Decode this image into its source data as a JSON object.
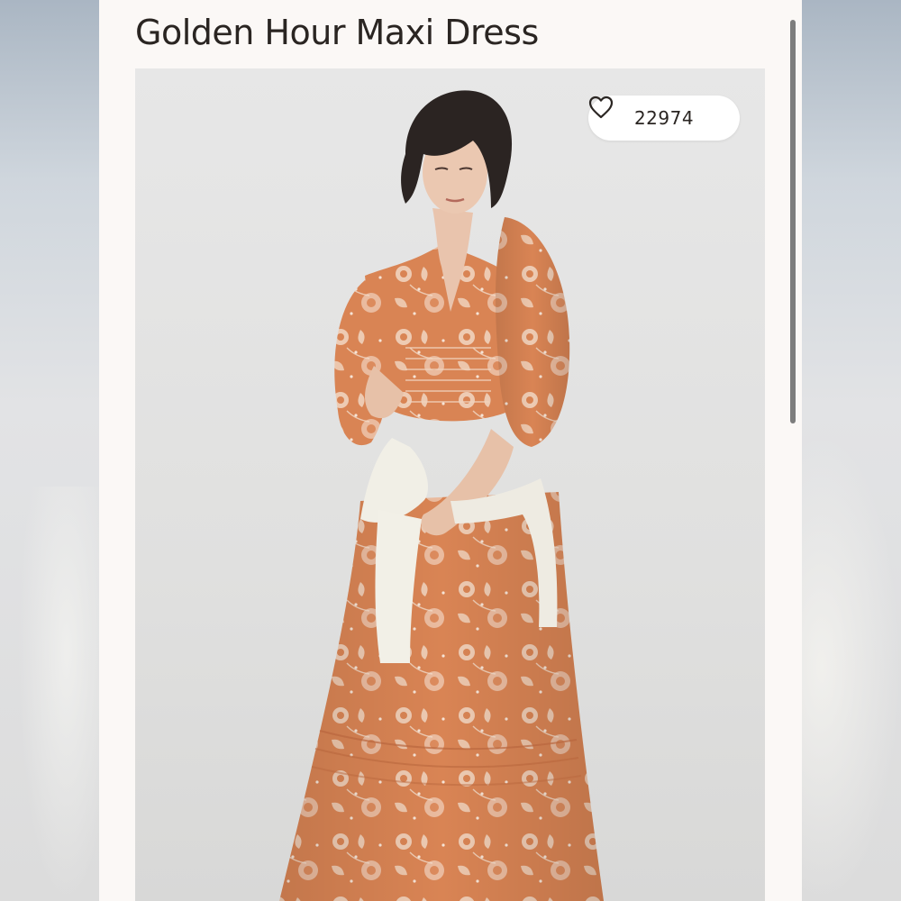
{
  "product": {
    "title": "Golden Hour Maxi Dress",
    "likes": "22974"
  },
  "icons": {
    "like": "heart-outline-icon"
  },
  "colors": {
    "card_background": "#fbf8f6",
    "dress_orange": "#d98454",
    "dress_print": "#f3d9c6",
    "photo_background": "#e3e3e2"
  }
}
